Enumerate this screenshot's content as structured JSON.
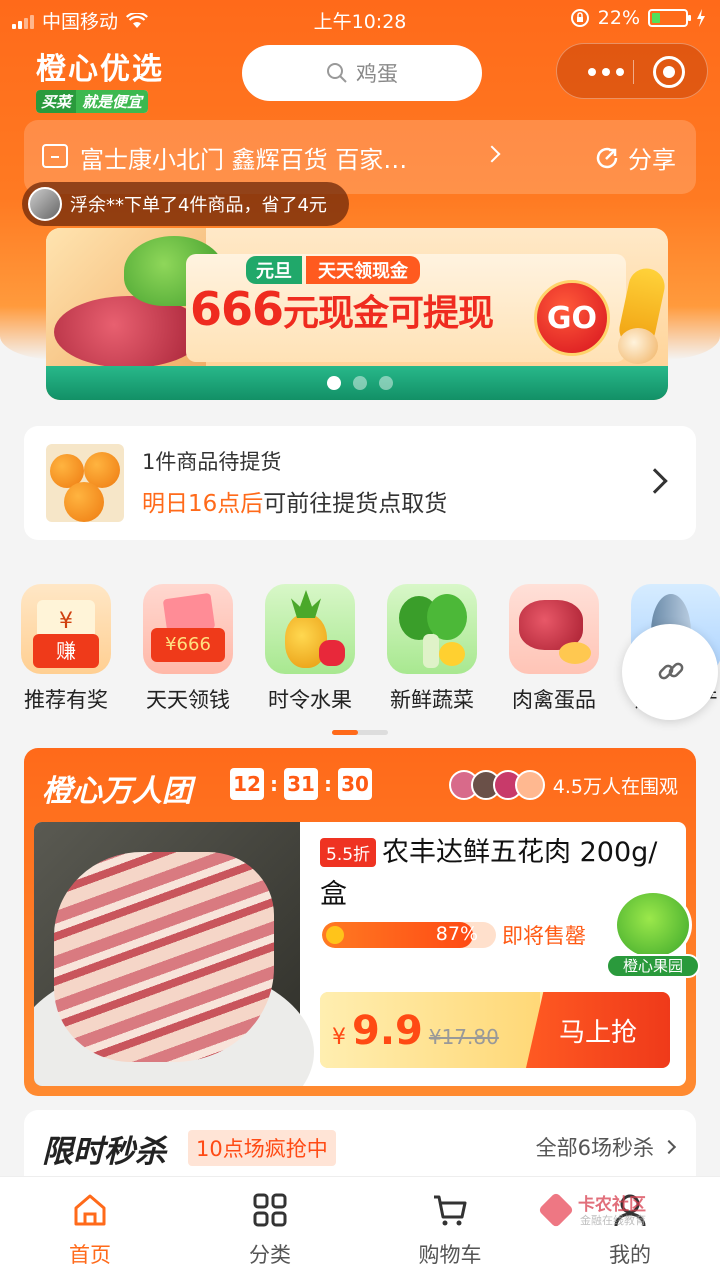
{
  "status_bar": {
    "carrier": "中国移动",
    "time": "上午10:28",
    "battery": "22%"
  },
  "header": {
    "logo_name": "橙心优选",
    "slogan_a": "买菜",
    "slogan_b": "就是便宜",
    "search_placeholder": "鸡蛋"
  },
  "store": {
    "name": "富士康小北门 鑫辉百货 百家…",
    "share_label": "分享",
    "order_ticker": "浮余**下单了4件商品，省了4元"
  },
  "banner": {
    "tag1": "元旦",
    "tag2": "天天领现金",
    "headline_num": "666",
    "headline_text": "元现金可提现",
    "go": "GO",
    "slide_count": 3,
    "active_slide": 1
  },
  "pickup": {
    "line1": "1件商品待提货",
    "highlight": "明日16点后",
    "rest": "可前往提货点取货"
  },
  "categories": [
    {
      "label": "推荐有奖",
      "icon": "reward-icon",
      "badge": "赚"
    },
    {
      "label": "天天领钱",
      "icon": "money-icon",
      "badge": "¥666"
    },
    {
      "label": "时令水果",
      "icon": "fruit-icon",
      "badge": ""
    },
    {
      "label": "新鲜蔬菜",
      "icon": "vegetable-icon",
      "badge": ""
    },
    {
      "label": "肉禽蛋品",
      "icon": "meat-icon",
      "badge": ""
    },
    {
      "label": "海鲜水产",
      "icon": "fish-icon",
      "badge": ""
    }
  ],
  "group_buy": {
    "title": "橙心万人团",
    "countdown": [
      "12",
      "31",
      "30"
    ],
    "watchers": "4.5万人在围观",
    "discount": "5.5折",
    "product_name": "农丰达鲜五花肉 200g/盒",
    "progress_pct": 87,
    "progress_label": "87%",
    "stock_status": "即将售罄",
    "currency": "¥",
    "price": "9.9",
    "original_price": "¥17.80",
    "buy_label": "马上抢",
    "orchard_label": "橙心果园"
  },
  "flash_sale": {
    "title": "限时秒杀",
    "tag": "10点场疯抢中",
    "all_label": "全部6场秒杀"
  },
  "tabbar": [
    {
      "label": "首页",
      "icon": "home-icon",
      "active": true
    },
    {
      "label": "分类",
      "icon": "grid-icon",
      "active": false
    },
    {
      "label": "购物车",
      "icon": "cart-icon",
      "active": false
    },
    {
      "label": "我的",
      "icon": "user-icon",
      "active": false
    }
  ],
  "watermark": {
    "brand": "卡农社区",
    "sub": "金融在线教育"
  },
  "colors": {
    "brand_orange": "#ff6a1a",
    "accent_red": "#ef3322",
    "green": "#2a9a3c"
  }
}
